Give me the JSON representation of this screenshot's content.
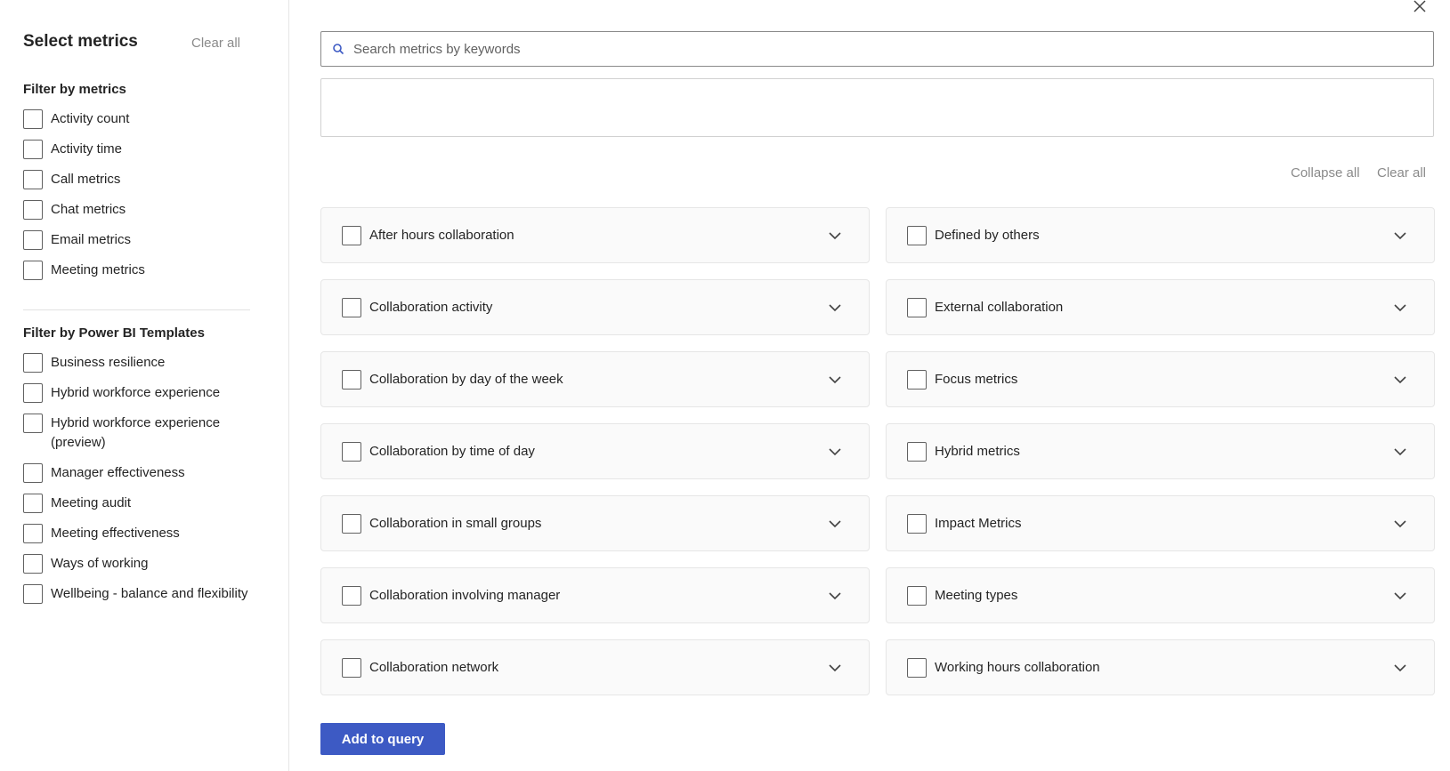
{
  "left_panel": {
    "title": "Select metrics",
    "clear_all": "Clear all",
    "filter_metrics": {
      "heading": "Filter by metrics",
      "items": [
        "Activity count",
        "Activity time",
        "Call metrics",
        "Chat metrics",
        "Email metrics",
        "Meeting metrics"
      ]
    },
    "filter_templates": {
      "heading": "Filter by Power BI Templates",
      "items": [
        "Business resilience",
        "Hybrid workforce experience",
        "Hybrid workforce experience (preview)",
        "Manager effectiveness",
        "Meeting audit",
        "Meeting effectiveness",
        "Ways of working",
        "Wellbeing - balance and flexibility"
      ]
    }
  },
  "search": {
    "placeholder": "Search metrics by keywords",
    "value": ""
  },
  "actions": {
    "collapse_all": "Collapse all",
    "clear_all": "Clear all"
  },
  "categories": {
    "left_column": [
      "After hours collaboration",
      "Collaboration activity",
      "Collaboration by day of the week",
      "Collaboration by time of day",
      "Collaboration in small groups",
      "Collaboration involving manager",
      "Collaboration network"
    ],
    "right_column": [
      "Defined by others",
      "External collaboration",
      "Focus metrics",
      "Hybrid metrics",
      "Impact Metrics",
      "Meeting types",
      "Working hours collaboration"
    ]
  },
  "add_button": "Add to query",
  "icons": {
    "close": "close-icon",
    "search": "search-icon",
    "chevron": "chevron-down-icon"
  },
  "colors": {
    "primary_button": "#3d5ac4",
    "muted_text": "#8a8a8a",
    "card_background": "#fafafa"
  }
}
